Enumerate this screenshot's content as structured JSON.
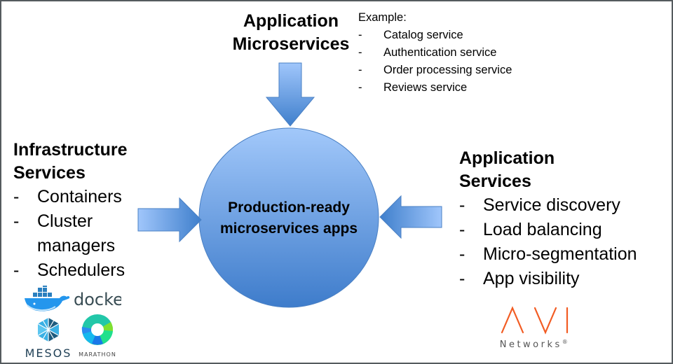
{
  "top": {
    "heading_line1": "Application",
    "heading_line2": "Microservices",
    "example_label": "Example:",
    "examples": [
      {
        "dash": "-",
        "label": "Catalog service"
      },
      {
        "dash": "-",
        "label": "Authentication service"
      },
      {
        "dash": "-",
        "label": "Order processing service"
      },
      {
        "dash": "-",
        "label": "Reviews service"
      }
    ]
  },
  "left": {
    "heading_line1": "Infrastructure",
    "heading_line2": "Services",
    "items": [
      {
        "dash": "-",
        "label": "Containers"
      },
      {
        "dash": "-",
        "label": "Cluster"
      },
      {
        "dash": "",
        "label": "managers"
      },
      {
        "dash": "-",
        "label": "Schedulers"
      }
    ],
    "logos": {
      "docker": "docker",
      "mesos": "MESOS",
      "marathon": "MARATHON"
    }
  },
  "right": {
    "heading_line1": "Application",
    "heading_line2": "Services",
    "items": [
      {
        "dash": "-",
        "label": "Service discovery"
      },
      {
        "dash": "-",
        "label": "Load balancing"
      },
      {
        "dash": "-",
        "label": "Micro-segmentation"
      },
      {
        "dash": "-",
        "label": "App visibility"
      }
    ],
    "logo": {
      "name": "AVI",
      "sub": "Networks",
      "mark": "®"
    }
  },
  "center": {
    "line1": "Production-ready",
    "line2": "microservices apps"
  },
  "colors": {
    "circle_top": "#9dc3f7",
    "circle_bottom": "#3f7fcc",
    "arrow_light": "#9ec5fa",
    "arrow_dark": "#3f7fcc",
    "avi_orange": "#f25c23",
    "docker_blue": "#2496ed",
    "frame": "#555b5e"
  }
}
